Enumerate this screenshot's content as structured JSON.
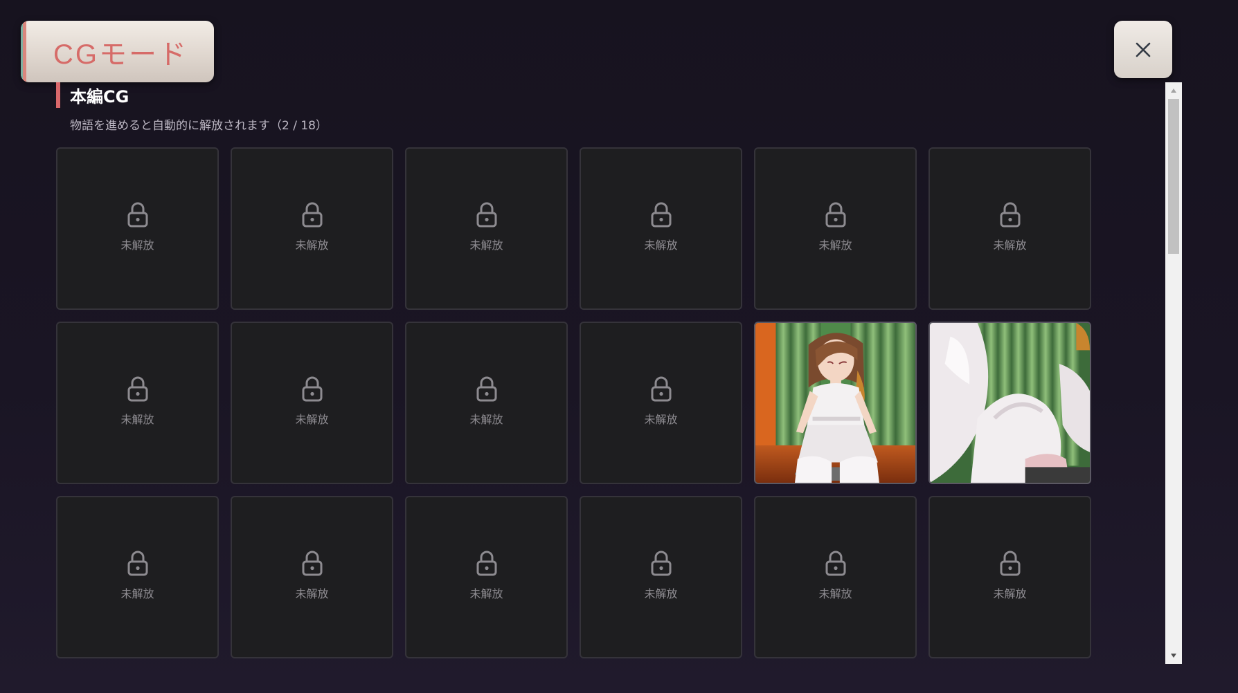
{
  "mode_badge": {
    "label": "CGモード"
  },
  "close_button": {
    "icon": "close-icon"
  },
  "section": {
    "title": "本編CG",
    "subtitle": "物語を進めると自動的に解放されます（2 / 18）",
    "accent_color": "#d9686b"
  },
  "gallery": {
    "locked_label": "未解放",
    "lock_icon": "lock-icon",
    "tiles": [
      {
        "state": "locked"
      },
      {
        "state": "locked"
      },
      {
        "state": "locked"
      },
      {
        "state": "locked"
      },
      {
        "state": "locked"
      },
      {
        "state": "locked"
      },
      {
        "state": "locked"
      },
      {
        "state": "locked"
      },
      {
        "state": "locked"
      },
      {
        "state": "locked"
      },
      {
        "state": "unlocked"
      },
      {
        "state": "unlocked"
      },
      {
        "state": "locked"
      },
      {
        "state": "locked"
      },
      {
        "state": "locked"
      },
      {
        "state": "locked"
      },
      {
        "state": "locked"
      },
      {
        "state": "locked"
      }
    ]
  },
  "scrollbar": {
    "position": 0
  }
}
